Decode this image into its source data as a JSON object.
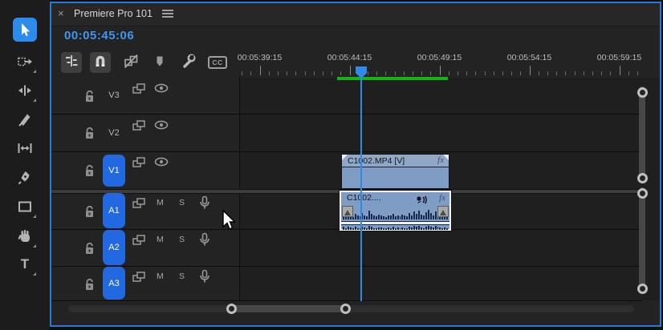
{
  "tab": {
    "close_label": "×",
    "title": "Premiere Pro 101"
  },
  "timecode": "00:05:45:06",
  "toolbar": {
    "buttons": [
      {
        "name": "nest",
        "active": true
      },
      {
        "name": "snap",
        "active": true
      },
      {
        "name": "linked-selection",
        "active": false
      },
      {
        "name": "add-marker",
        "active": false
      },
      {
        "name": "timeline-display-settings",
        "active": false
      },
      {
        "name": "captions",
        "active": false,
        "label": "CC"
      }
    ]
  },
  "ruler": {
    "labels": [
      "00:05:39:15",
      "00:05:44:15",
      "00:05:49:15",
      "00:05:54:15",
      "00:05:59:15"
    ]
  },
  "tools": [
    "selection",
    "track-select-forward",
    "ripple-edit",
    "razor",
    "slip",
    "pen",
    "rectangle",
    "hand",
    "type"
  ],
  "tracks": {
    "video": [
      {
        "label": "V3",
        "targeted": false
      },
      {
        "label": "V2",
        "targeted": false
      },
      {
        "label": "V1",
        "targeted": true
      }
    ],
    "audio": [
      {
        "label": "A1",
        "targeted": true
      },
      {
        "label": "A2",
        "targeted": true
      },
      {
        "label": "A3",
        "targeted": true
      }
    ],
    "audio_controls": {
      "mute": "M",
      "solo": "S"
    }
  },
  "clips": {
    "video": {
      "name": "C1002.MP4 [V]",
      "fx_badge": "fx"
    },
    "audio": {
      "name": "C1002....",
      "fx_badge": "fx"
    }
  },
  "waveform": {
    "top": [
      0.35,
      0.2,
      0.5,
      0.3,
      0.15,
      0.4,
      0.25,
      0.2,
      0.45,
      0.3,
      0.2,
      0.6,
      0.4,
      0.25,
      0.2,
      0.35,
      0.3,
      0.2,
      0.15,
      0.3,
      0.25,
      0.4,
      0.2,
      0.3,
      0.2,
      0.35,
      0.25,
      0.2,
      0.45,
      0.3,
      0.55,
      0.4,
      0.6,
      0.35,
      0.25,
      0.5,
      0.65,
      0.45,
      0.3,
      0.55,
      0.4,
      0.3,
      0.2,
      0.35,
      0.25
    ],
    "bottom": [
      0.5,
      0.3,
      0.6,
      0.4,
      0.3,
      0.5,
      0.35,
      0.3,
      0.55,
      0.4,
      0.3,
      0.7,
      0.5,
      0.35,
      0.3,
      0.45,
      0.4,
      0.3,
      0.25,
      0.4,
      0.35,
      0.5,
      0.3,
      0.4,
      0.3,
      0.45,
      0.35,
      0.3,
      0.55,
      0.4,
      0.65,
      0.5,
      0.7,
      0.45,
      0.35,
      0.6,
      0.75,
      0.55,
      0.4,
      0.65,
      0.5,
      0.4,
      0.3,
      0.45,
      0.35
    ]
  },
  "colors": {
    "accent_blue": "#2d8ceb",
    "badge_blue": "#2268e0",
    "timecode_blue": "#3e96f2",
    "render_bar_green": "#12b512",
    "clip_fill": "#7f9dc4",
    "waveform_navy": "#16294d",
    "panel_border_blue": "#2a78d8"
  }
}
